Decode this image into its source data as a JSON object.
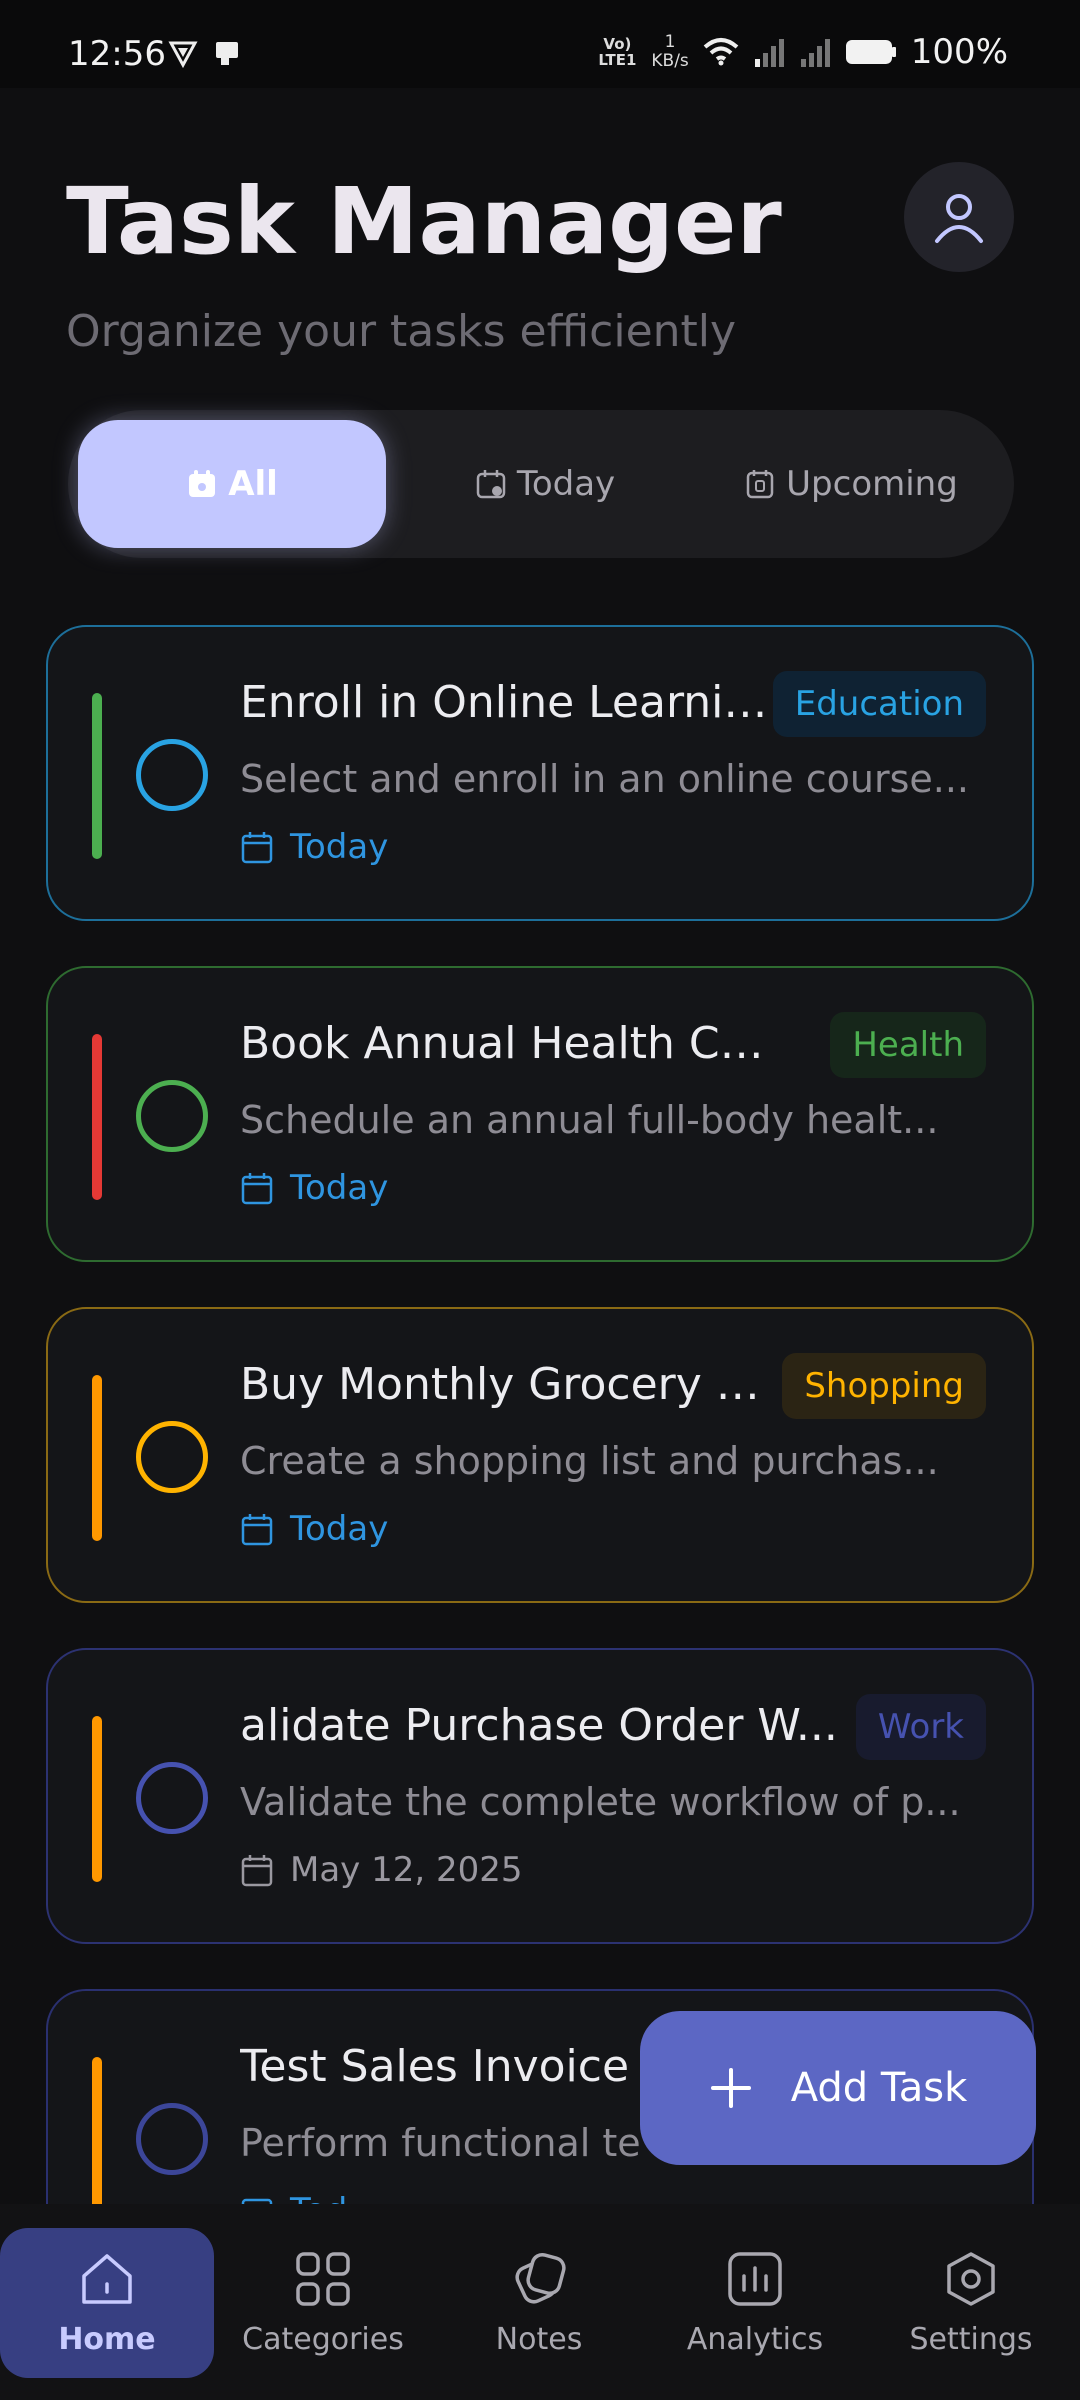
{
  "status_bar": {
    "time": "12:56",
    "network_label": "Vo) LTE1",
    "speed_value": "1",
    "speed_unit": "KB/s",
    "battery": "100%"
  },
  "header": {
    "title": "Task Manager",
    "subtitle": "Organize your tasks efficiently"
  },
  "filters": [
    {
      "label": "All",
      "icon": "calendar-today-icon",
      "active": true
    },
    {
      "label": "Today",
      "icon": "calendar-check-icon",
      "active": false
    },
    {
      "label": "Upcoming",
      "icon": "calendar-date-icon",
      "active": false
    }
  ],
  "tasks": [
    {
      "title": "Enroll in Online Learnin...",
      "description": "Select and enroll in an online course...",
      "category": "Education",
      "date": "Today",
      "category_color": "#29a3e3",
      "priority_color": "#4caf50",
      "date_color": "#2f95e0"
    },
    {
      "title": "Book Annual Health Che...",
      "description": "Schedule an annual full-body healt...",
      "category": "Health",
      "date": "Today",
      "category_color": "#4caf50",
      "priority_color": "#e53935",
      "date_color": "#2f95e0"
    },
    {
      "title": "Buy Monthly Grocery E...",
      "description": "Create a shopping list and purchas...",
      "category": "Shopping",
      "date": "Today",
      "category_color": "#ffb300",
      "priority_color": "#ff9800",
      "date_color": "#2f95e0"
    },
    {
      "title": "alidate Purchase Order W...",
      "description": "Validate the complete workflow of p...",
      "category": "Work",
      "date": "May 12, 2025",
      "category_color": "#4652b0",
      "priority_color": "#ff9800",
      "date_color": "#9a98a0"
    },
    {
      "title": "Test Sales Invoice",
      "description": "Perform functional te",
      "date": "Tod",
      "category_color": "#3c4699",
      "priority_color": "#ff9800",
      "date_color": "#2f95e0"
    }
  ],
  "fab": {
    "label": "Add Task",
    "icon": "plus-icon"
  },
  "bottom_nav": [
    {
      "label": "Home",
      "icon": "home-icon",
      "active": true
    },
    {
      "label": "Categories",
      "icon": "grid-icon",
      "active": false
    },
    {
      "label": "Notes",
      "icon": "notes-icon",
      "active": false
    },
    {
      "label": "Analytics",
      "icon": "analytics-icon",
      "active": false
    },
    {
      "label": "Settings",
      "icon": "settings-icon",
      "active": false
    }
  ],
  "colors": {
    "accent": "#c2c7ff",
    "fab": "#5c67c4",
    "nav_active": "#373f82",
    "background": "#0f0f11"
  }
}
